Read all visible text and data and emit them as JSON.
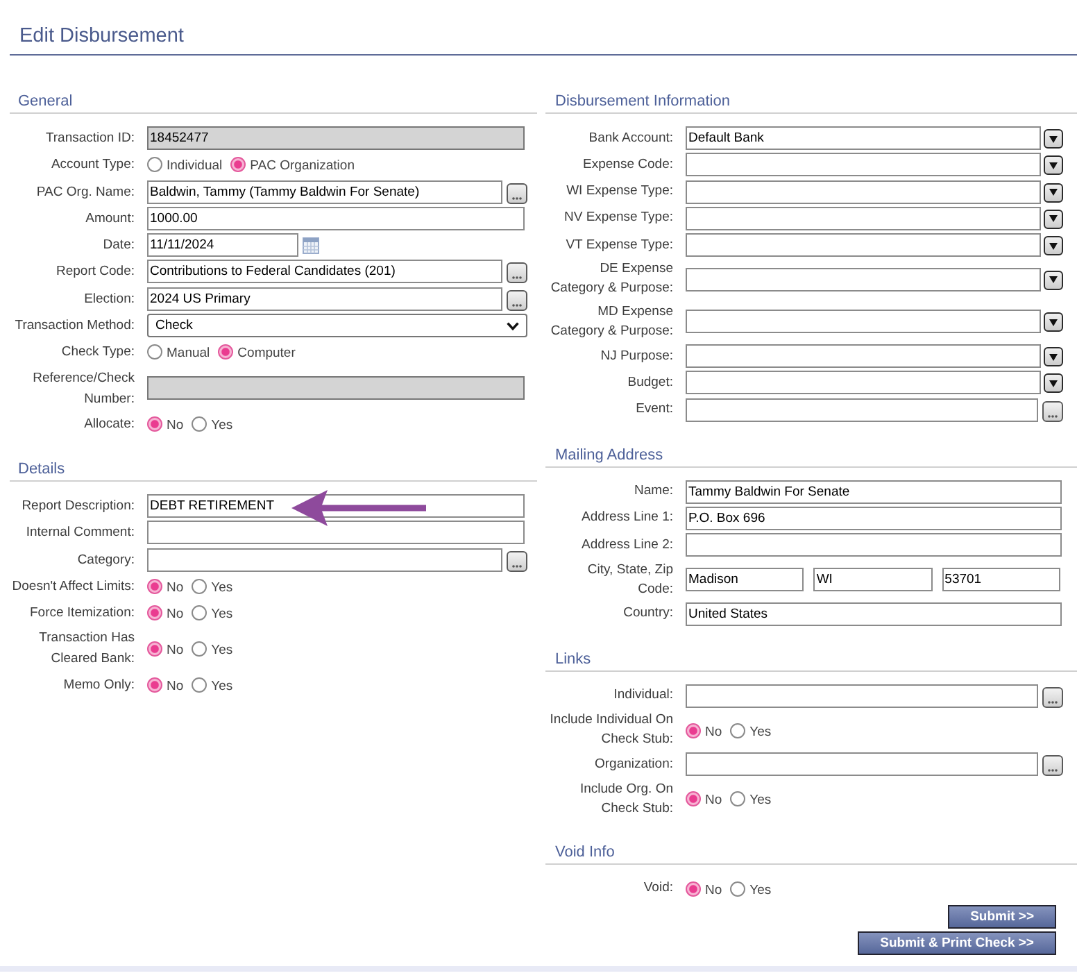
{
  "title": "Edit Disbursement",
  "columns": [
    {
      "sections": [
        {
          "title": "General",
          "fields": [
            {
              "label": "Transaction ID:",
              "kind": "locked",
              "value": "18452477"
            },
            {
              "label": "Account Type:",
              "kind": "radio",
              "options": [
                {
                  "label": "Individual",
                  "selected": false
                },
                {
                  "label": "PAC Organization",
                  "selected": true
                }
              ]
            },
            {
              "label": "PAC Org. Name:",
              "kind": "lookup",
              "value": "Baldwin, Tammy (Tammy Baldwin For Senate)"
            },
            {
              "label": "Amount:",
              "kind": "text",
              "value": "1000.00"
            },
            {
              "label": "Date:",
              "kind": "date",
              "value": "11/11/2024"
            },
            {
              "label": "Report Code:",
              "kind": "lookup",
              "value": "Contributions to Federal Candidates (201)"
            },
            {
              "label": "Election:",
              "kind": "lookup",
              "value": "2024 US Primary"
            },
            {
              "label": "Transaction Method:",
              "kind": "select",
              "value": "Check"
            },
            {
              "label": "Check Type:",
              "kind": "radio",
              "options": [
                {
                  "label": "Manual",
                  "selected": false
                },
                {
                  "label": "Computer",
                  "selected": true
                }
              ]
            },
            {
              "label": "Reference/Check Number:",
              "kind": "locked"
            },
            {
              "label": "Allocate:",
              "kind": "radio",
              "options": [
                {
                  "label": "No",
                  "selected": true
                },
                {
                  "label": "Yes",
                  "selected": false
                }
              ]
            }
          ]
        },
        {
          "title": "Details",
          "fields": [
            {
              "label": "Report Description:",
              "kind": "text",
              "value": "DEBT RETIREMENT"
            },
            {
              "label": "Internal Comment:",
              "kind": "text"
            },
            {
              "label": "Category:",
              "kind": "lookup"
            },
            {
              "label": "Doesn't Affect Limits:",
              "kind": "radio",
              "options": [
                {
                  "label": "No",
                  "selected": true
                },
                {
                  "label": "Yes",
                  "selected": false
                }
              ]
            },
            {
              "label": "Force Itemization:",
              "kind": "radio",
              "options": [
                {
                  "label": "No",
                  "selected": true
                },
                {
                  "label": "Yes",
                  "selected": false
                }
              ]
            },
            {
              "label": "Transaction Has Cleared Bank:",
              "kind": "radio",
              "options": [
                {
                  "label": "No",
                  "selected": true
                },
                {
                  "label": "Yes",
                  "selected": false
                }
              ]
            },
            {
              "label": "Memo Only:",
              "kind": "radio",
              "options": [
                {
                  "label": "No",
                  "selected": true
                },
                {
                  "label": "Yes",
                  "selected": false
                }
              ]
            }
          ]
        }
      ]
    },
    {
      "sections": [
        {
          "title": "Disbursement Information",
          "fields": [
            {
              "label": "Bank Account:",
              "kind": "combo",
              "value": "Default Bank"
            },
            {
              "label": "Expense Code:",
              "kind": "combo"
            },
            {
              "label": "WI Expense Type:",
              "kind": "combo"
            },
            {
              "label": "NV Expense Type:",
              "kind": "combo"
            },
            {
              "label": "VT Expense Type:",
              "kind": "combo"
            },
            {
              "label": "DE Expense Category & Purpose:",
              "kind": "combo"
            },
            {
              "label": "MD Expense Category & Purpose:",
              "kind": "combo"
            },
            {
              "label": "NJ Purpose:",
              "kind": "combo"
            },
            {
              "label": "Budget:",
              "kind": "combo"
            },
            {
              "label": "Event:",
              "kind": "lookup"
            }
          ]
        },
        {
          "title": "Mailing Address",
          "fields": [
            {
              "label": "Name:",
              "kind": "text",
              "value": "Tammy Baldwin For Senate"
            },
            {
              "label": "Address Line 1:",
              "kind": "text",
              "value": "P.O. Box 696"
            },
            {
              "label": "Address Line 2:",
              "kind": "text"
            },
            {
              "label": "City, State, Zip\nCode:",
              "kind": "address",
              "values": [
                "Madison",
                "WI",
                "53701"
              ]
            },
            {
              "label": "Country:",
              "kind": "text",
              "value": "United States"
            }
          ]
        },
        {
          "title": "Links",
          "fields": [
            {
              "label": "Individual:",
              "kind": "lookup"
            },
            {
              "label": "Include Individual On Check Stub:",
              "kind": "radio",
              "options": [
                {
                  "label": "No",
                  "selected": true
                },
                {
                  "label": "Yes",
                  "selected": false
                }
              ]
            },
            {
              "label": "Organization:",
              "kind": "lookup"
            },
            {
              "label": "Include Org. On Check Stub:",
              "kind": "radio",
              "options": [
                {
                  "label": "No",
                  "selected": true
                },
                {
                  "label": "Yes",
                  "selected": false
                }
              ]
            }
          ]
        },
        {
          "title": "Void Info",
          "fields": [
            {
              "label": "Void:",
              "kind": "radio",
              "options": [
                {
                  "label": "No",
                  "selected": true
                },
                {
                  "label": "Yes",
                  "selected": false
                }
              ]
            }
          ]
        }
      ],
      "buttons": [
        {
          "label": "Submit >>"
        },
        {
          "label": "Submit & Print Check >>"
        }
      ]
    }
  ]
}
